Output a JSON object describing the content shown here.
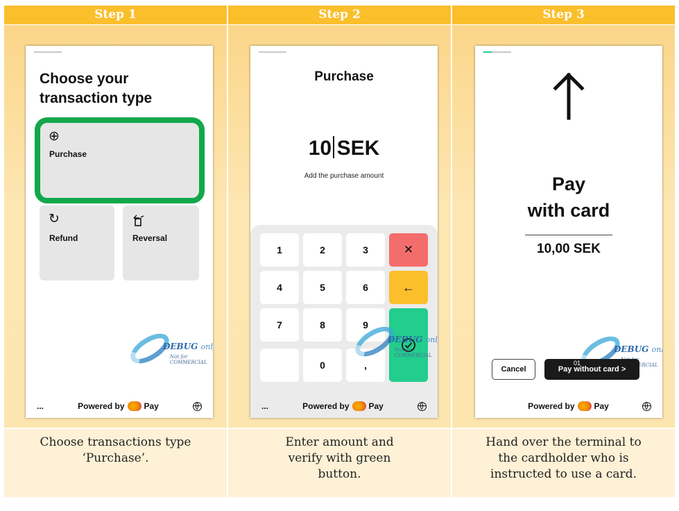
{
  "headers": [
    "Step 1",
    "Step 2",
    "Step 3"
  ],
  "captions": [
    "Choose transactions type ‘Purchase’.",
    "Enter amount and verify with green button.",
    "Hand over the terminal to the cardholder who is instructed to use a card."
  ],
  "colors": {
    "header": "#fbbf2c",
    "highlight": "#12a84b",
    "cancel_key": "#f46d6d",
    "back_key": "#fbbf2c",
    "confirm_key": "#22cd8d"
  },
  "footer": {
    "more": "...",
    "powered": "Powered by",
    "pay": "Pay"
  },
  "debug": {
    "text": "DEBUG",
    "only": "only",
    "note": "Not for COMMERCIAL"
  },
  "screen1": {
    "title": "Choose your transaction type",
    "tiles": [
      {
        "label": "Purchase",
        "icon": "plus-circle-icon"
      },
      {
        "label": "Refund",
        "icon": "refresh-icon"
      },
      {
        "label": "Reversal",
        "icon": "reversal-icon"
      }
    ]
  },
  "screen2": {
    "title": "Purchase",
    "amount": "10",
    "currency": "SEK",
    "hint": "Add the purchase amount",
    "keys": [
      "1",
      "2",
      "3",
      "4",
      "5",
      "6",
      "7",
      "8",
      "9",
      "0",
      ","
    ]
  },
  "screen3": {
    "line1": "Pay",
    "line2": "with card",
    "amount": "10,00 SEK",
    "cancel": "Cancel",
    "pay_without": "Pay without card >",
    "overlay_text": "01"
  }
}
